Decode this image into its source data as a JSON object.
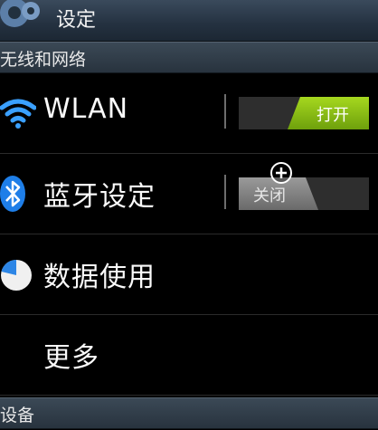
{
  "header": {
    "title": "设定",
    "icon": "gear-icon"
  },
  "sections": {
    "wireless": "无线和网络",
    "device": "设备"
  },
  "items": [
    {
      "label": "WLAN",
      "icon": "wifi-icon",
      "toggle_label": "打开",
      "state": "on"
    },
    {
      "label": "蓝牙设定",
      "icon": "bluetooth-icon",
      "toggle_label": "关闭",
      "state": "off"
    },
    {
      "label": "数据使用",
      "icon": "pie-chart-icon"
    },
    {
      "label": "更多"
    }
  ],
  "colors": {
    "toggle_on": "#8cc414",
    "toggle_off": "#888888",
    "section_bg": "#2f3b47"
  }
}
